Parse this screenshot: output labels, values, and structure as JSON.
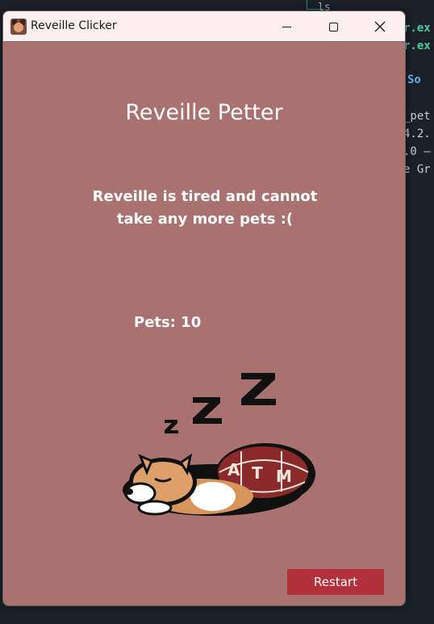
{
  "window": {
    "title": "Reveille Clicker",
    "icon": "reveille-dog-icon"
  },
  "controls": {
    "minimize_icon": "minimize-icon",
    "maximize_icon": "maximize-icon",
    "close_icon": "close-icon"
  },
  "main": {
    "heading": "Reveille Petter",
    "message": "Reveille is tired and cannot take any more pets :(",
    "pets_label": "Pets: 10",
    "image": "sleeping-dog-image",
    "restart_label": "Restart"
  },
  "background_terminal": {
    "lines": [
      "r.ex",
      "r.ex",
      "So",
      "_pet",
      "4.2.",
      ".0 –",
      "e Gr"
    ],
    "ls_text": "ls"
  },
  "colors": {
    "window_bg": "#a97170",
    "titlebar_bg": "#fbeff0",
    "restart_bg": "#b2303a",
    "text": "#ffffff"
  }
}
